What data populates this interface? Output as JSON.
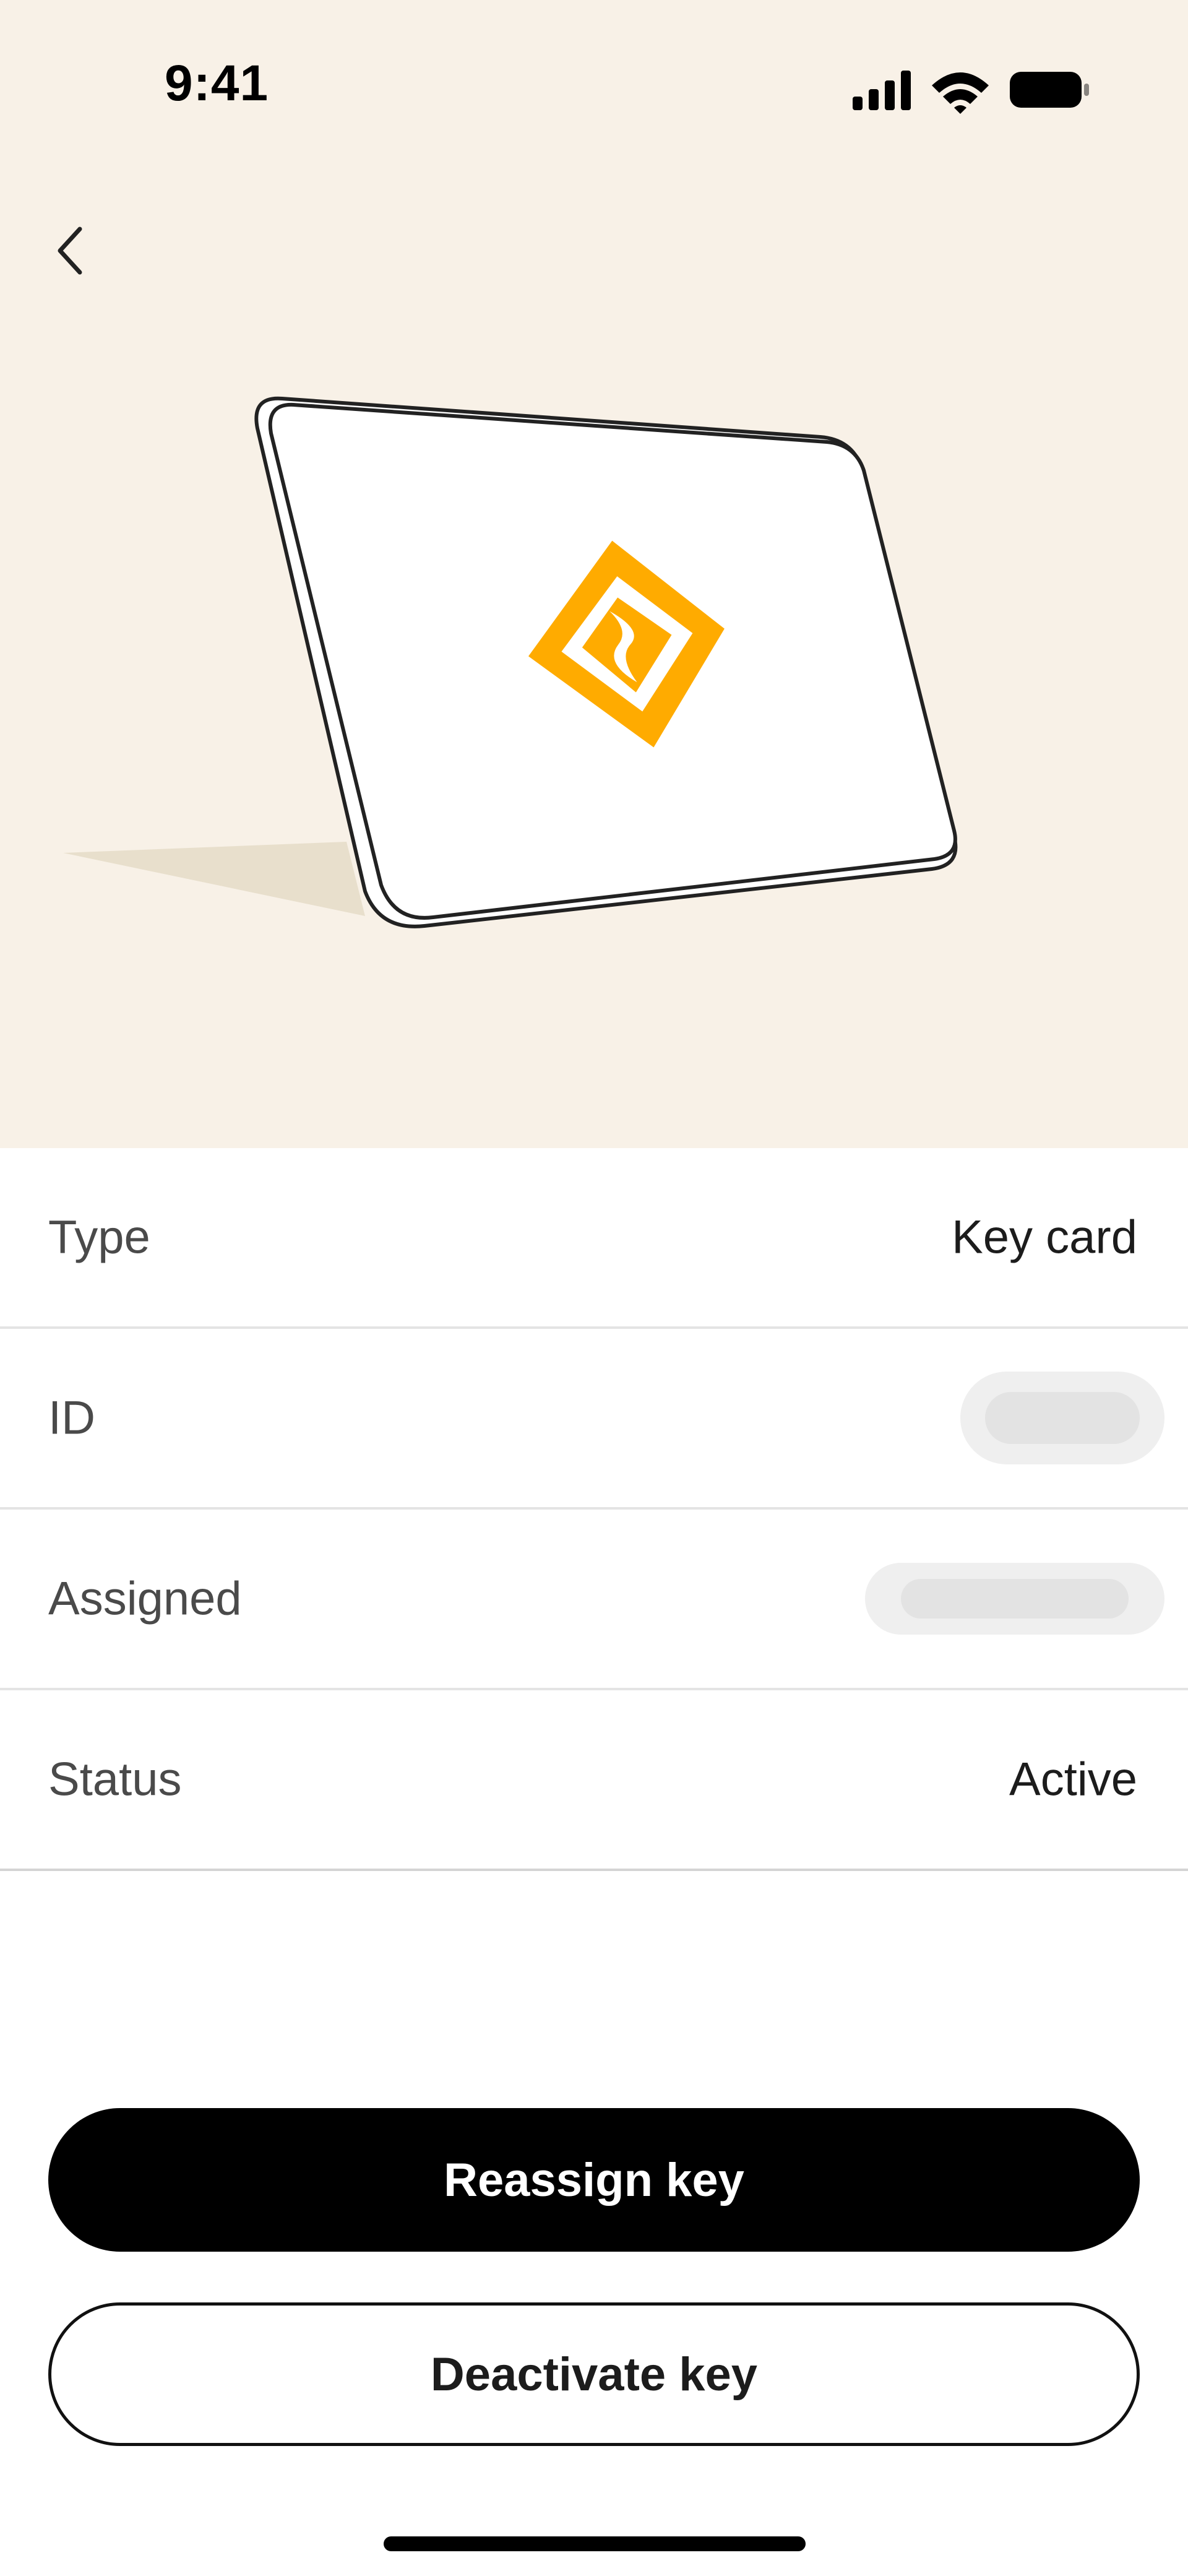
{
  "status_bar": {
    "time": "9:41",
    "icons": [
      "cellular-signal-icon",
      "wifi-icon",
      "battery-icon"
    ]
  },
  "nav": {
    "back_icon": "chevron-left-icon"
  },
  "hero": {
    "illustration": "key-card-illustration",
    "logo_icon": "rivian-logo-icon",
    "background_color": "#f8f1e7",
    "logo_color": "#ffab00"
  },
  "details": [
    {
      "label": "Type",
      "value": "Key card"
    },
    {
      "label": "ID",
      "value": null
    },
    {
      "label": "Assigned",
      "value": null
    },
    {
      "label": "Status",
      "value": "Active"
    }
  ],
  "actions": {
    "primary_label": "Reassign key",
    "secondary_label": "Deactivate key"
  }
}
